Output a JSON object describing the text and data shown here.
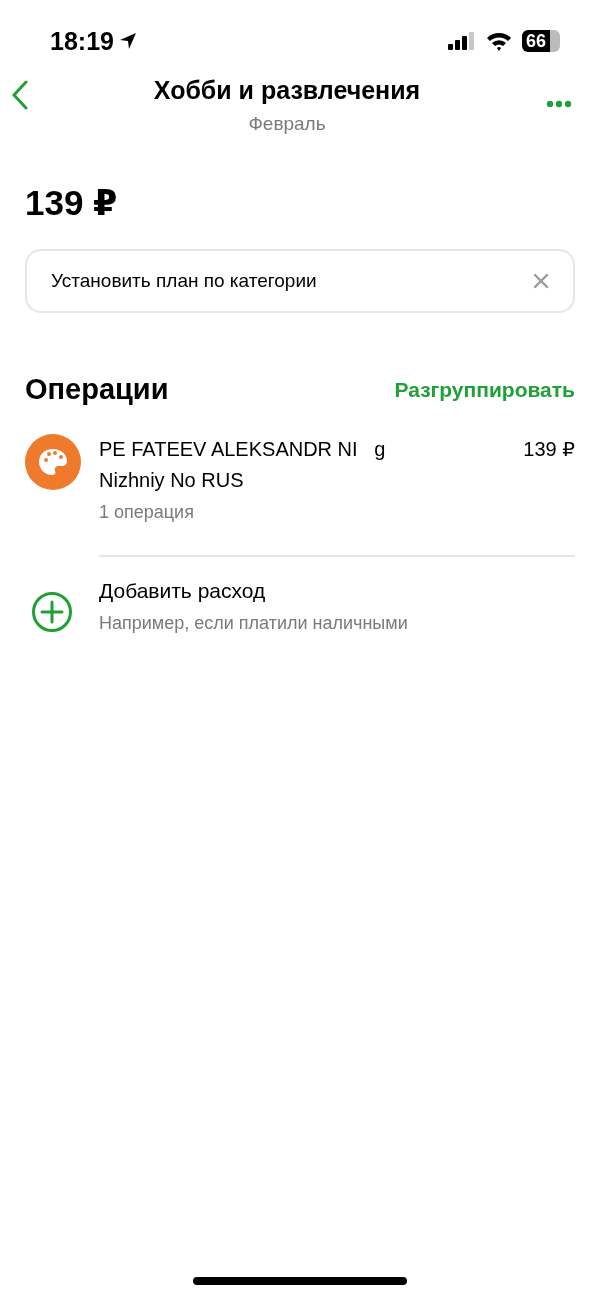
{
  "status_bar": {
    "time": "18:19",
    "battery": "66"
  },
  "header": {
    "title": "Хобби и развлечения",
    "subtitle": "Февраль"
  },
  "total": "139 ₽",
  "plan_banner": {
    "label": "Установить план по категории"
  },
  "operations": {
    "title": "Операции",
    "action": "Разгруппировать",
    "items": [
      {
        "name_lines": [
          "PE FATEEV ALEKSANDR NI   g",
          "Nizhniy No RUS"
        ],
        "count": "1 операция",
        "amount": "139 ₽",
        "color": "#f07a2c"
      }
    ]
  },
  "add_expense": {
    "title": "Добавить расход",
    "hint": "Например, если платили наличными"
  }
}
